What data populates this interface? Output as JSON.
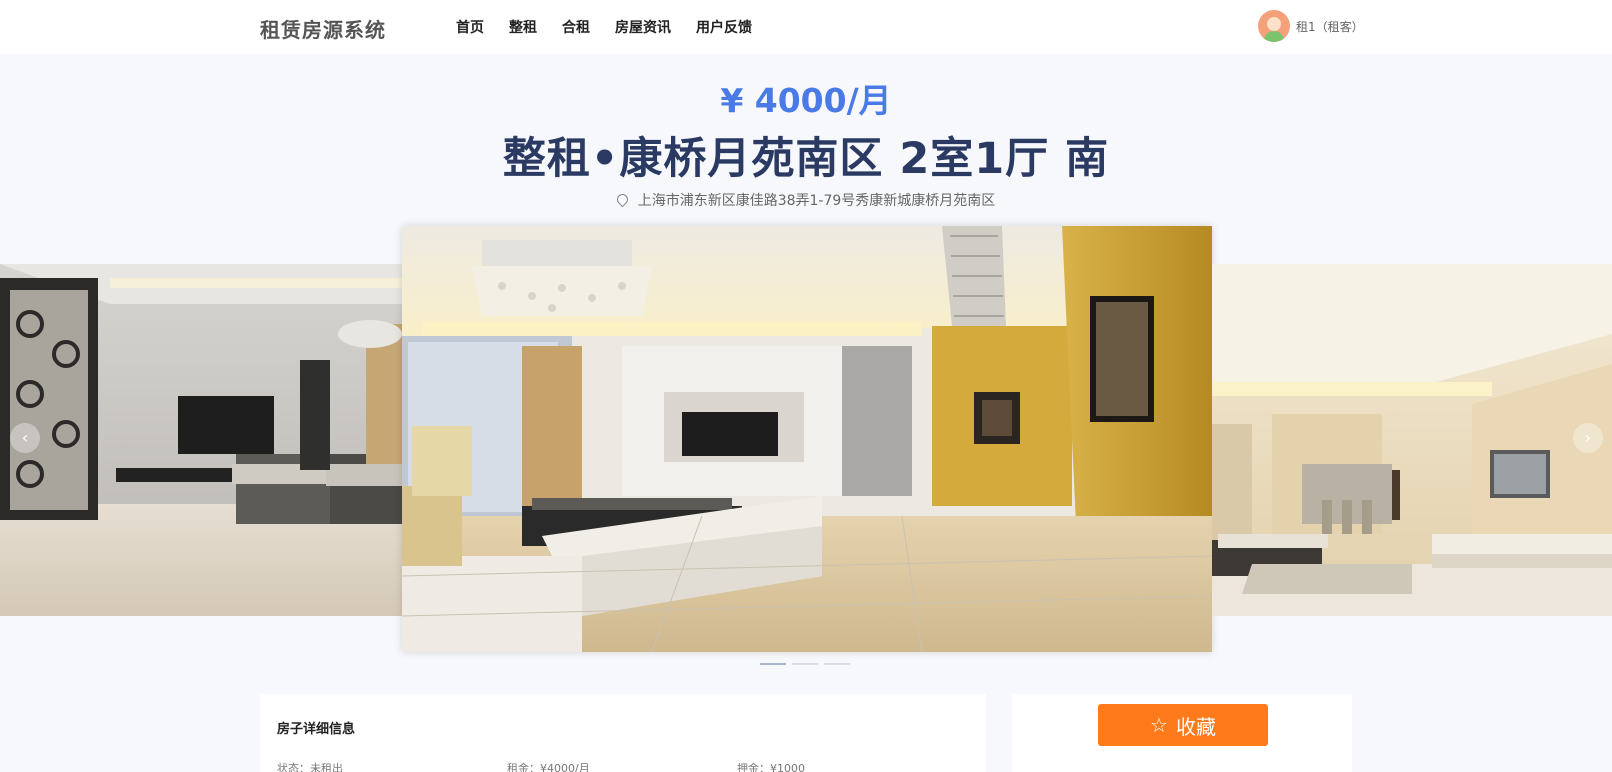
{
  "header": {
    "brand": "租赁房源系统",
    "nav": [
      {
        "label": "首页"
      },
      {
        "label": "整租"
      },
      {
        "label": "合租"
      },
      {
        "label": "房屋资讯"
      },
      {
        "label": "用户反馈"
      }
    ],
    "user": {
      "name": "租1（租客）"
    }
  },
  "house": {
    "price": "¥ 4000/月",
    "title": "整租•康桥月苑南区 2室1厅 南",
    "address": "上海市浦东新区康佳路38弄1-79号秀康新城康桥月苑南区"
  },
  "carousel": {
    "arrow_left": "‹",
    "arrow_right": "›",
    "slide_count": 3,
    "active_slide": 1
  },
  "details": {
    "title": "房子详细信息",
    "items": [
      {
        "text": "状态：未租出"
      },
      {
        "text": "租金：¥4000/月"
      },
      {
        "text": "押金：¥1000"
      }
    ]
  },
  "actions": {
    "favorite_icon": "☆",
    "favorite_label": "收藏"
  },
  "colors": {
    "price": "#4a7ae6",
    "title": "#2b3a63",
    "favorite_button": "#ff7a1a"
  }
}
